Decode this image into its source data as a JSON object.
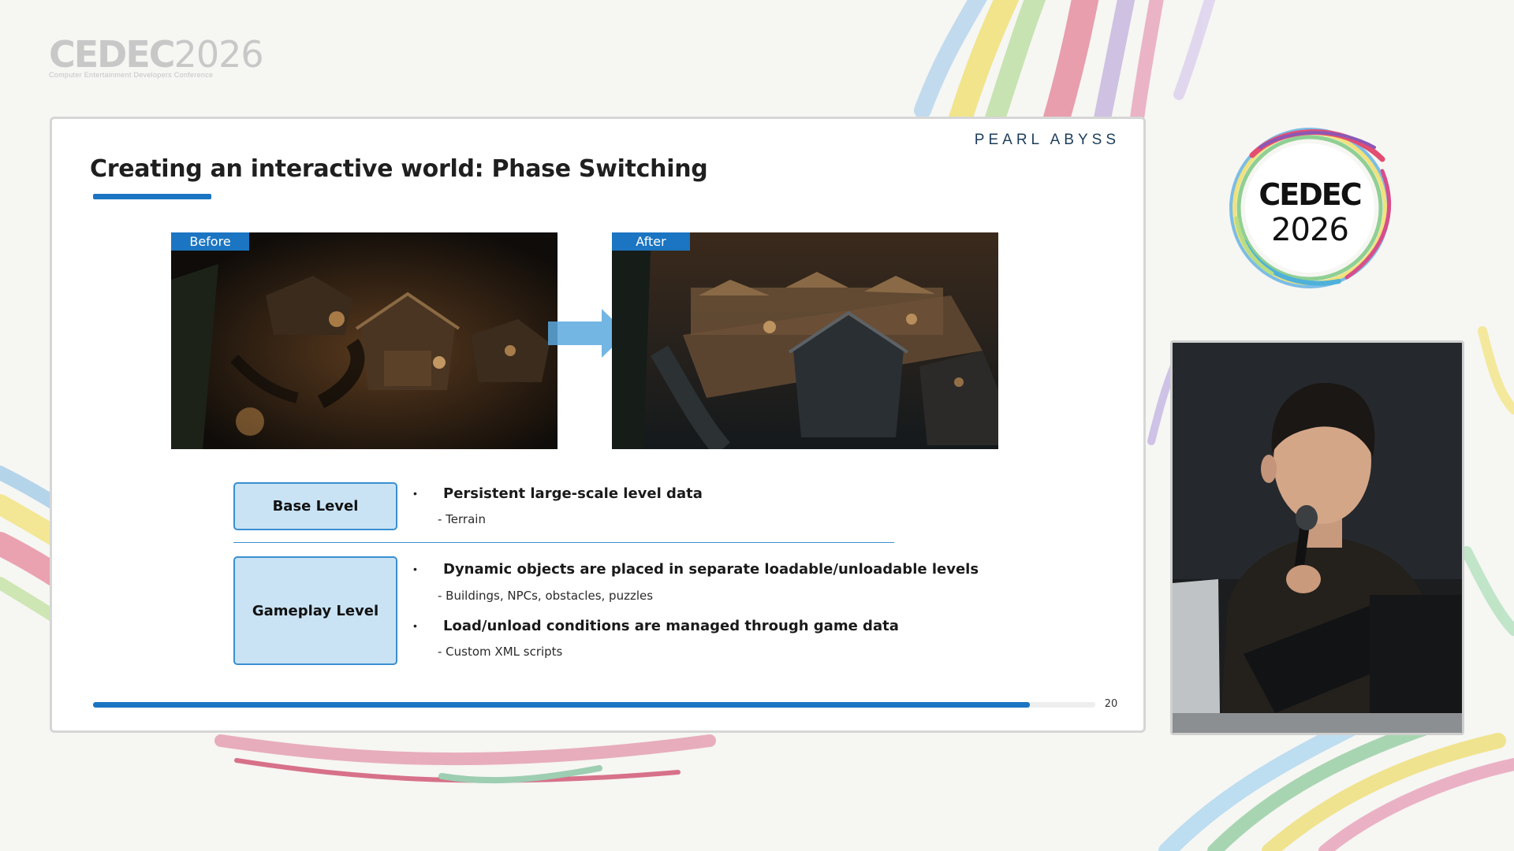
{
  "event": {
    "logo_text": "CEDEC",
    "logo_year": "2026",
    "logo_subtitle": "Computer Entertainment Developers Conference"
  },
  "slide": {
    "brand": "PEARL ABYSS",
    "title": "Creating an interactive world: Phase Switching",
    "before_label": "Before",
    "after_label": "After",
    "levels": [
      {
        "name": "Base Level",
        "points": [
          {
            "text": "Persistent large-scale level data",
            "detail": "- Terrain"
          }
        ]
      },
      {
        "name": "Gameplay Level",
        "points": [
          {
            "text": "Dynamic objects are placed in separate loadable/unloadable levels",
            "detail": "- Buildings, NPCs, obstacles, puzzles"
          },
          {
            "text": "Load/unload conditions are managed through game data",
            "detail": "- Custom XML scripts"
          }
        ]
      }
    ],
    "bullet_glyph": "•",
    "progress_fraction": 0.935,
    "page_number": "20"
  },
  "colors": {
    "accent": "#1b75c2",
    "box_fill": "#c9e3f5",
    "box_border": "#3a8fd0"
  }
}
